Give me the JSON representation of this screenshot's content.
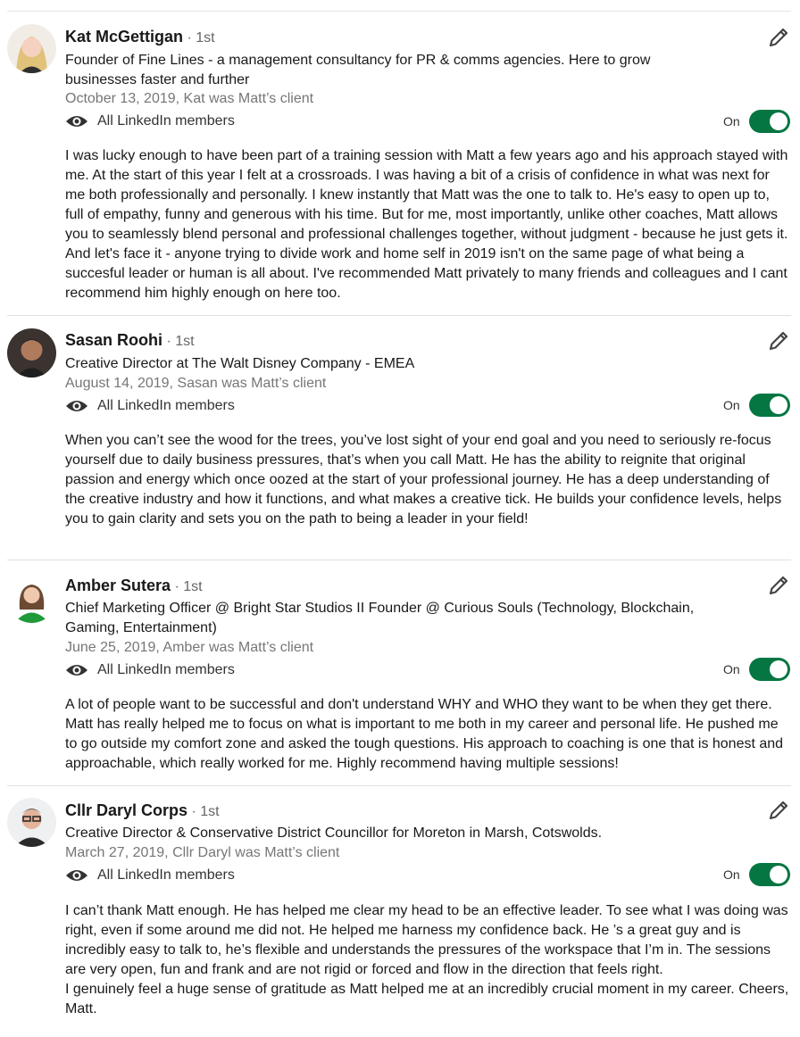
{
  "recommendations": [
    {
      "name": "Kat McGettigan",
      "degree": "· 1st",
      "headline": "Founder of Fine Lines - a management consultancy for PR & comms agencies. Here to grow businesses faster and further",
      "date": "October 13, 2019, Kat was Matt’s client",
      "visibility": "All LinkedIn members",
      "toggle_label": "On",
      "text": "I was lucky enough to have been part of a training session with Matt a few years ago and his approach stayed with me. At the start of this year I felt at a crossroads. I was having a bit of a crisis of confidence in what was next for me both professionally and personally. I knew instantly that Matt was the one to talk to. He's easy to open up to, full of empathy, funny and generous with his time. But for me, most importantly, unlike other coaches, Matt allows you to seamlessly blend personal and professional challenges together, without judgment - because he just gets it. And let's face it - anyone trying to divide work and home self in 2019 isn't on the same page of what being a succesful leader or human is all about. I've recommended Matt privately to many friends and colleagues and I cant recommend him highly enough on here too."
    },
    {
      "name": "Sasan Roohi",
      "degree": "· 1st",
      "headline": "Creative Director at The Walt Disney Company - EMEA",
      "date": "August 14, 2019, Sasan was Matt’s client",
      "visibility": "All LinkedIn members",
      "toggle_label": "On",
      "text": "When you can’t see the wood for the trees, you’ve lost sight of your end goal and you need to seriously re-focus yourself due to daily business pressures, that’s when you call Matt. He has the ability to reignite that original passion and energy which once oozed at the start of your professional journey. He has a deep understanding of the creative industry and how it functions, and what makes a creative tick. He builds your confidence levels, helps you to gain clarity and sets you on the path to being a leader in your field!"
    },
    {
      "name": "Amber Sutera",
      "degree": "· 1st",
      "headline": "Chief Marketing Officer @ Bright Star Studios II Founder @ Curious Souls (Technology, Blockchain, Gaming, Entertainment)",
      "date": "June 25, 2019, Amber was Matt’s client",
      "visibility": "All LinkedIn members",
      "toggle_label": "On",
      "text": "A lot of people want to be successful and don't understand WHY and WHO they want to be when they get there. Matt has really helped me to focus on what is important to me both in my career and personal life. He pushed me to go outside my comfort zone and asked the tough questions. His approach to coaching is one that is honest and approachable, which really worked for me. Highly recommend having multiple sessions!"
    },
    {
      "name": "Cllr Daryl Corps",
      "degree": "· 1st",
      "headline": "Creative Director & Conservative District Councillor for Moreton in Marsh, Cotswolds.",
      "date": "March 27, 2019, Cllr Daryl was Matt’s client",
      "visibility": "All LinkedIn members",
      "toggle_label": "On",
      "text": "I can’t thank Matt enough. He has helped me clear my head to be an effective leader. To see what I was doing was right, even if some around me did not. He helped me harness my confidence back. He ’s a great guy and is incredibly easy to talk to, he’s flexible and understands the pressures of the workspace that I’m in. The sessions are very open, fun and frank and are not rigid or forced and flow in the direction that feels right.\nI genuinely feel a huge sense of gratitude as Matt helped me at an incredibly crucial moment in my career. Cheers, Matt."
    }
  ],
  "colors": {
    "toggle_on": "#057642",
    "secondary_text": "#767676",
    "divider": "#e0e0e0"
  },
  "icons": {
    "edit": "pencil-icon",
    "visibility": "eye-icon"
  }
}
